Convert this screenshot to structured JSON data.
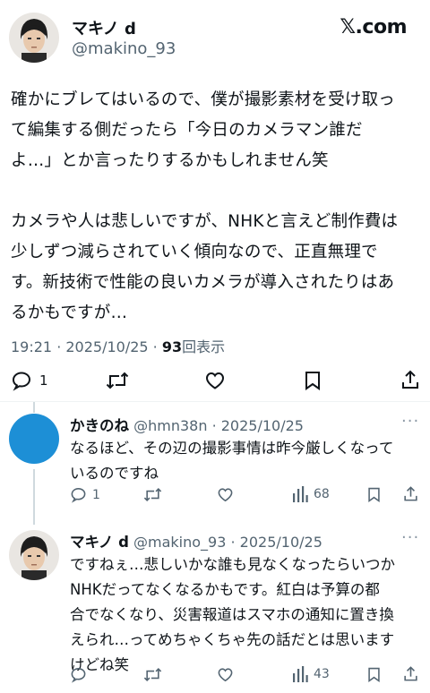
{
  "main_post": {
    "author_name": "マキノ d",
    "author_handle": "@makino_93",
    "brand": "𝕏.com",
    "lines": [
      "確かにブレてはいるので、僕が撮影素材を受け取っ",
      "て編集する側だったら「今日のカメラマン誰だ",
      "よ…」とか言ったりするかもしれません笑",
      "",
      "カメラや人は悲しいですが、NHKと言えど制作費は",
      "少しずつ減らされていく傾向なので、正直無理で",
      "す。新技術で性能の良いカメラが導入されたりはあ",
      "るかもですが…"
    ],
    "timestamp": "19:21 · 2025/10/25 · ",
    "views": "93",
    "views_label": "回表示",
    "reply_count": "1"
  },
  "replies": [
    {
      "author_name": "かきのね",
      "author_handle": "@hmn38n",
      "date": "· 2025/10/25",
      "avatar_color": "#1d8fd6",
      "lines": [
        "なるほど、その辺の撮影事情は昨今厳しくなって",
        "いるのですね"
      ],
      "reply_count": "1",
      "view_count": "68"
    },
    {
      "author_name": "マキノ d",
      "author_handle": "@makino_93",
      "date": "· 2025/10/25",
      "lines": [
        "ですねぇ…悲しいかな誰も見なくなったらいつか",
        "NHKだってなくなるかもです。紅白は予算の都",
        "合でなくなり、災害報道はスマホの通知に置き換",
        "えられ…ってめちゃくちゃ先の話だとは思います",
        "けどね笑"
      ],
      "view_count": "43"
    }
  ],
  "more_label": "···",
  "icons": [
    "reply-icon",
    "retweet-icon",
    "like-icon",
    "bookmark-icon",
    "share-icon",
    "views-icon",
    "more-icon"
  ]
}
